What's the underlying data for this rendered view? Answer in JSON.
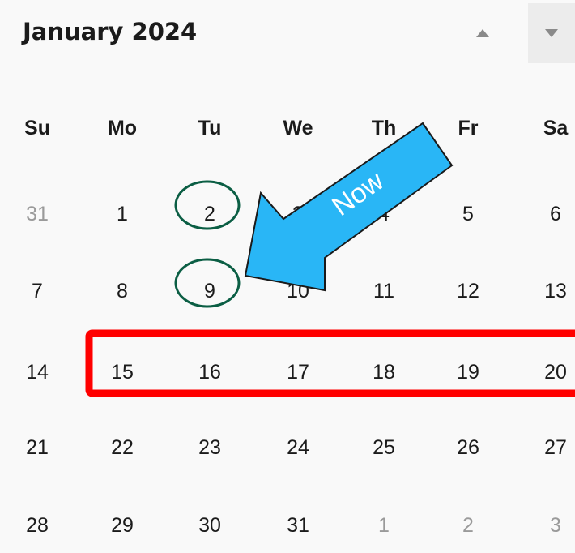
{
  "header": {
    "month_title": "January 2024",
    "prev_icon": "triangle-up-icon",
    "next_icon": "triangle-down-icon"
  },
  "weekdays": [
    "Su",
    "Mo",
    "Tu",
    "We",
    "Th",
    "Fr",
    "Sa"
  ],
  "weeks": [
    [
      {
        "d": "31",
        "muted": true
      },
      {
        "d": "1"
      },
      {
        "d": "2"
      },
      {
        "d": "3"
      },
      {
        "d": "4"
      },
      {
        "d": "5"
      },
      {
        "d": "6"
      }
    ],
    [
      {
        "d": "7"
      },
      {
        "d": "8"
      },
      {
        "d": "9"
      },
      {
        "d": "10"
      },
      {
        "d": "11"
      },
      {
        "d": "12"
      },
      {
        "d": "13"
      }
    ],
    [
      {
        "d": "14"
      },
      {
        "d": "15"
      },
      {
        "d": "16"
      },
      {
        "d": "17"
      },
      {
        "d": "18"
      },
      {
        "d": "19"
      },
      {
        "d": "20"
      }
    ],
    [
      {
        "d": "21"
      },
      {
        "d": "22"
      },
      {
        "d": "23"
      },
      {
        "d": "24"
      },
      {
        "d": "25"
      },
      {
        "d": "26"
      },
      {
        "d": "27"
      }
    ],
    [
      {
        "d": "28"
      },
      {
        "d": "29"
      },
      {
        "d": "30"
      },
      {
        "d": "31"
      },
      {
        "d": "1",
        "muted": true
      },
      {
        "d": "2",
        "muted": true
      },
      {
        "d": "3",
        "muted": true
      }
    ]
  ],
  "annotations": {
    "arrow_label": "Now",
    "arrow_color": "#29b6f6",
    "highlight_color": "#ff0000",
    "circle_color": "#0b5e44",
    "circled_dates": [
      "2",
      "9"
    ],
    "highlighted_week": [
      "15",
      "16",
      "17",
      "18",
      "19",
      "20"
    ]
  },
  "colors": {
    "background": "#f9f9f9",
    "text": "#1b1b1b",
    "muted_text": "#9a9a9a"
  }
}
